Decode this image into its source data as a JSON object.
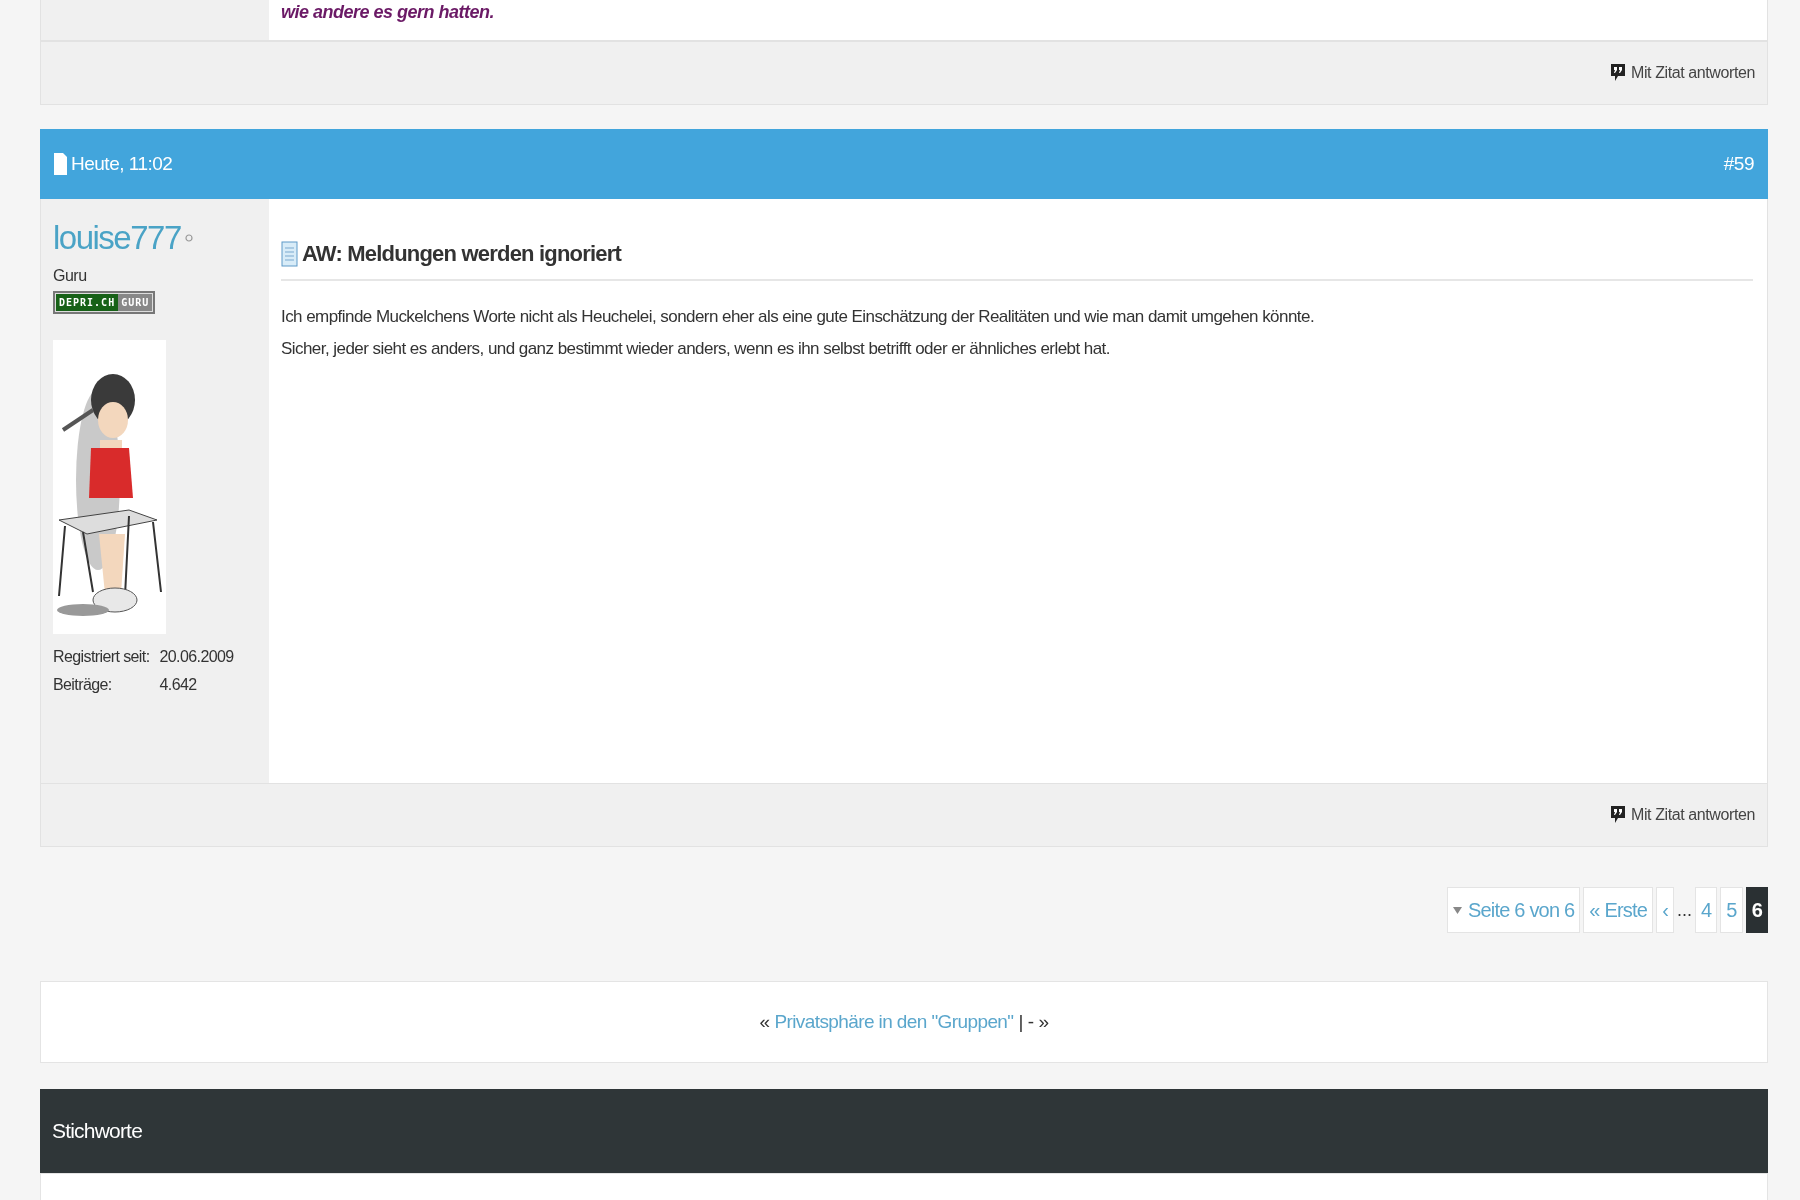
{
  "previous_post": {
    "text_tail": "wie andere es gern hatten.",
    "reply_link": "Mit Zitat antworten"
  },
  "post": {
    "date": "Heute, 11:02",
    "number": "#59",
    "user": {
      "name": "louise777",
      "online": false,
      "rank": "Guru",
      "badge": [
        "DEPRI.CH",
        "GURU"
      ],
      "avatar": {
        "kind": "picture"
      },
      "stats": [
        {
          "label": "Registriert seit:",
          "value": "20.06.2009"
        },
        {
          "label": "Beiträge:",
          "value": "4.642"
        }
      ]
    },
    "title": "AW: Meldungen werden ignoriert",
    "lines": [
      "Ich empfinde Muckelchens Worte nicht als Heuchelei, sondern eher als eine gute Einschätzung der Realitäten und wie man damit umgehen könnte.",
      "Sicher, jeder sieht es anders, und ganz bestimmt wieder anders, wenn es ihn selbst betrifft oder er ähnliches erlebt hat."
    ],
    "reply_link": "Mit Zitat antworten"
  },
  "pagination": {
    "label": "Seite 6 von 6",
    "first": "« Erste",
    "prev": "‹",
    "ellipsis": "...",
    "pages": [
      {
        "label": "4",
        "selected": false
      },
      {
        "label": "5",
        "selected": false
      },
      {
        "label": "6",
        "selected": true
      }
    ]
  },
  "thread_nav": {
    "prev_mark": "«",
    "prev_link": "Privatsphäre in den \"Gruppen\"",
    "separator": "|",
    "next_link": "-",
    "next_mark": "»"
  },
  "tags_section": {
    "title": "Stichworte"
  }
}
